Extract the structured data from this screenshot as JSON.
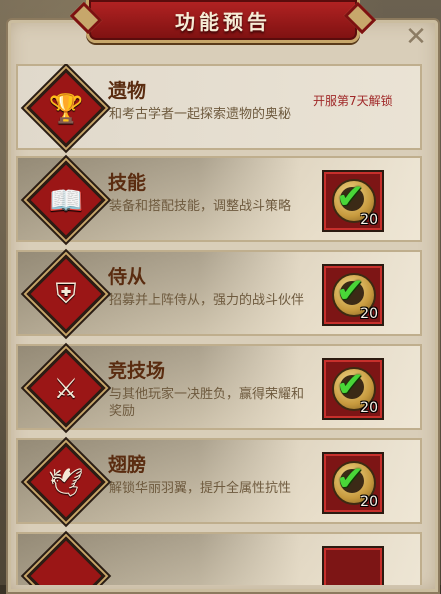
{
  "window": {
    "title": "功能预告"
  },
  "items": [
    {
      "icon": "trophy-icon",
      "name": "遗物",
      "desc": "和考古学者一起探索遗物的奥秘",
      "status": "开服第7天解锁"
    },
    {
      "icon": "book-icon",
      "name": "技能",
      "desc": "装备和搭配技能，调整战斗策略",
      "reward_count": "20"
    },
    {
      "icon": "helmet-icon",
      "name": "侍从",
      "desc": "招募并上阵侍从，强力的战斗伙伴",
      "reward_count": "20"
    },
    {
      "icon": "crossed-axes-icon",
      "name": "竞技场",
      "desc": "与其他玩家一决胜负，赢得荣耀和奖励",
      "reward_count": "20"
    },
    {
      "icon": "wings-icon",
      "name": "翅膀",
      "desc": "解锁华丽羽翼，提升全属性抗性",
      "reward_count": "20"
    },
    {
      "icon": "emblem-icon",
      "name": "",
      "desc": "",
      "reward_count": ""
    }
  ],
  "colors": {
    "banner": "#9b1616",
    "check": "#49d638",
    "unlock_text": "#a02828"
  }
}
